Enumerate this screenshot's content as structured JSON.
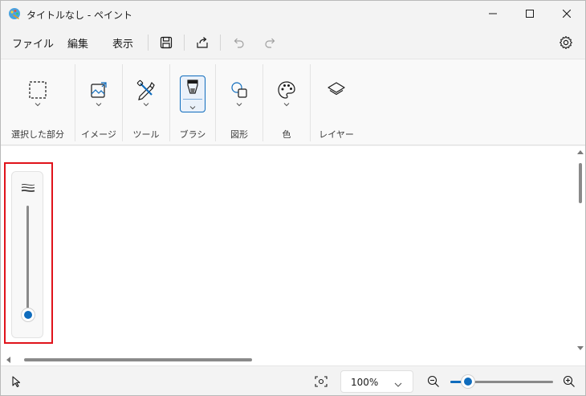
{
  "window": {
    "title": "タイトルなし - ペイント"
  },
  "menu": {
    "file": "ファイル",
    "edit": "編集",
    "view": "表示"
  },
  "ribbon": {
    "groups": [
      {
        "label": "選択した部分",
        "icon": "selection-icon"
      },
      {
        "label": "イメージ",
        "icon": "image-icon"
      },
      {
        "label": "ツール",
        "icon": "tools-icon"
      },
      {
        "label": "ブラシ",
        "icon": "brush-icon"
      },
      {
        "label": "図形",
        "icon": "shapes-icon"
      },
      {
        "label": "色",
        "icon": "palette-icon"
      },
      {
        "label": "レイヤー",
        "icon": "layers-icon"
      }
    ]
  },
  "brush_size": {
    "level": 0.03
  },
  "status": {
    "zoom": "100%",
    "zoom_slider_level": 0.17
  },
  "colors": {
    "accent": "#0f6cbd",
    "highlight": "#e0131b"
  }
}
